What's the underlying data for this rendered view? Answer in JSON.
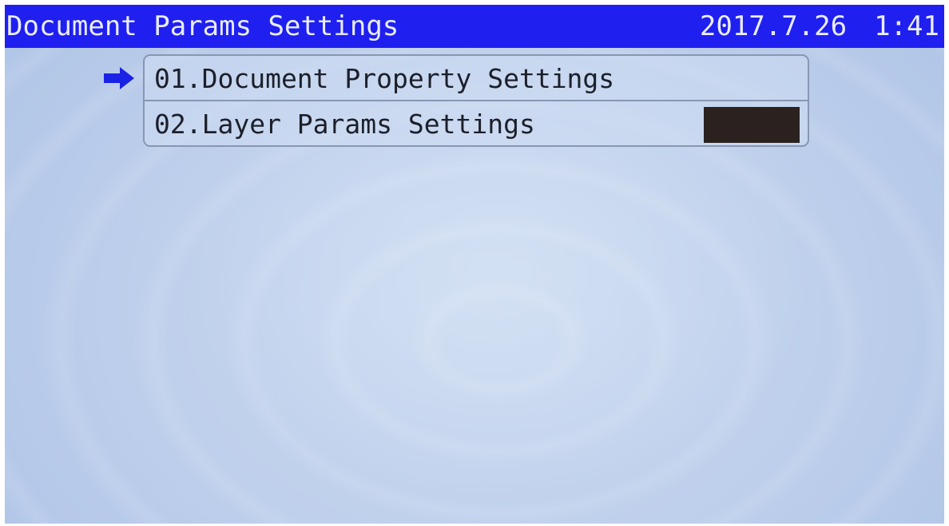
{
  "header": {
    "title": "Document Params Settings",
    "date": "2017.7.26",
    "time": "1:41"
  },
  "menu": {
    "items": [
      {
        "label": "01.Document Property Settings",
        "selected": true
      },
      {
        "label": "02.Layer Params Settings",
        "selected": false
      }
    ]
  },
  "icons": {
    "pointer": "right-arrow-icon"
  },
  "colors": {
    "title_bar": "#1f1ff0",
    "pointer": "#1a22e6",
    "value_box": "#2b2220"
  }
}
